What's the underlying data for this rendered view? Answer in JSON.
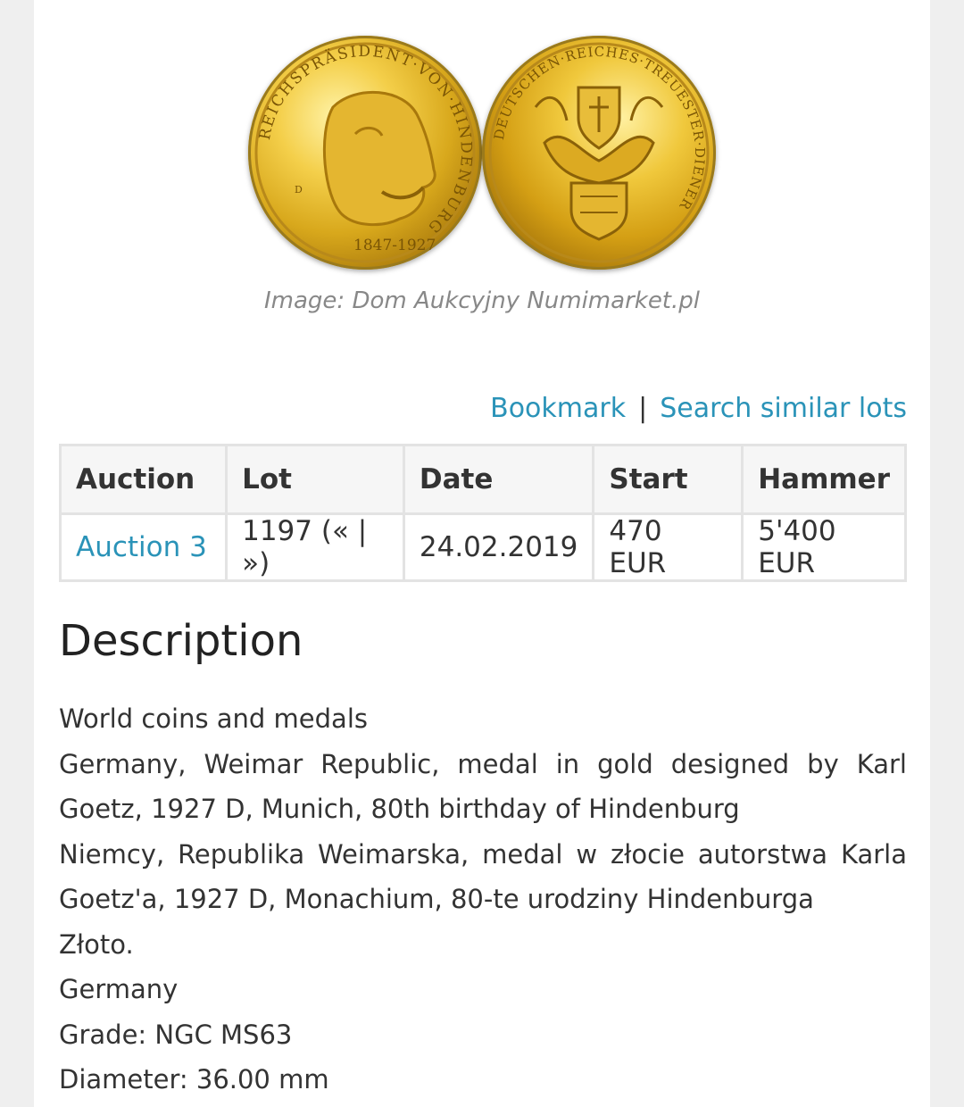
{
  "image": {
    "caption": "Image: Dom Aukcyjny Numimarket.pl",
    "obverse_legend": "REICHSPRÄSIDENT·VON·HINDENBURG",
    "obverse_dates": "1847-1927",
    "obverse_mintmark": "D",
    "reverse_legend": "DEUTSCHEN·REICHES·TREUESTER·DIENER"
  },
  "actions": {
    "bookmark": "Bookmark",
    "separator": "|",
    "search_similar": "Search similar lots"
  },
  "table": {
    "headers": [
      "Auction",
      "Lot",
      "Date",
      "Start",
      "Hammer"
    ],
    "row": {
      "auction": "Auction 3",
      "lot": "1197 (« | »)",
      "date": "24.02.2019",
      "start": "470 EUR",
      "hammer": "5'400 EUR"
    }
  },
  "description": {
    "title": "Description",
    "lines": [
      "World coins and medals",
      "Germany, Weimar Republic, medal in gold designed by Karl Goetz, 1927 D, Munich, 80th birthday of Hindenburg",
      "Niemcy, Republika Weimarska, medal w złocie autorstwa Karla Goetz'a, 1927 D, Monachium, 80-te urodziny Hindenburga",
      "Złoto.",
      "Germany",
      "Grade: NGC MS63",
      "Diameter: 36.00 mm"
    ]
  },
  "colors": {
    "link": "#2a93b8",
    "gold": "#d8a81c"
  }
}
